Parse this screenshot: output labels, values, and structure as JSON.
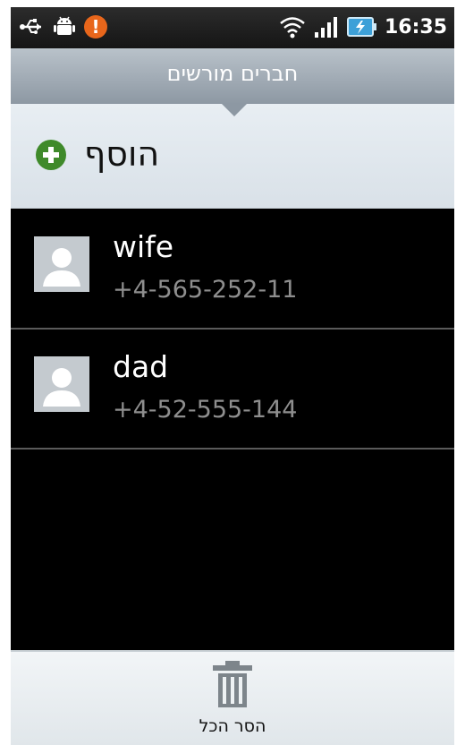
{
  "status_bar": {
    "time": "16:35",
    "icons": [
      "usb-icon",
      "android-debug-icon",
      "alert-icon",
      "wifi-icon",
      "signal-icon",
      "battery-icon"
    ],
    "alert_symbol": "!",
    "alert_color": "#e8661b"
  },
  "header": {
    "title": "חברים מורשים"
  },
  "add_action": {
    "label": "הוסף",
    "icon": "add-icon",
    "icon_color": "#3f8a2a"
  },
  "contacts": [
    {
      "name": "wife",
      "phone": "+4-565-252-11",
      "icon": "contact-avatar-icon"
    },
    {
      "name": "dad",
      "phone": "+4-52-555-144",
      "icon": "contact-avatar-icon"
    }
  ],
  "bottom_bar": {
    "label": "הסר הכל",
    "icon": "trash-icon"
  },
  "colors": {
    "background": "#000000",
    "header": "#9aa5af",
    "add_row": "#e1e8ee",
    "contact_name": "#ffffff",
    "contact_phone": "#8e8e8e"
  }
}
